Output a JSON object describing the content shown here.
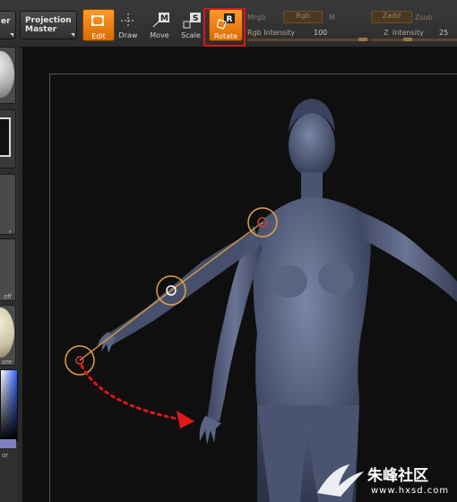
{
  "toolbar": {
    "partial_label": "er",
    "projection_master": "Projection Master",
    "edit": "Edit",
    "draw": "Draw",
    "move": "Move",
    "scale": "Scale",
    "rotate": "Rotate",
    "mrgb_label": "Mrgb",
    "rgb_pill": "Rgb",
    "m_label": "M",
    "rgb_intensity_label": "Rgb Intensity",
    "rgb_intensity_value": "100",
    "zadd_pill": "Zadd",
    "zsub_label": "Zsub",
    "z_label": "Z",
    "z_intensity_label": "Intensity",
    "z_intensity_value": "25"
  },
  "sidebar": {
    "label_r": "r",
    "label_off": "off",
    "label_ore": "ore",
    "label_or": "or"
  },
  "colors": {
    "accent_orange": "#f08a1c",
    "highlight_red": "#d81818",
    "figure": "#4a5570",
    "joint_ring": "#e6a040",
    "arrow": "#e01818"
  },
  "watermark": {
    "cn_text": "朱峰社区",
    "url": "www.hxsd.com"
  }
}
